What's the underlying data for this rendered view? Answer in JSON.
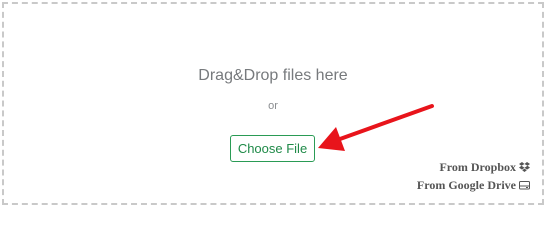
{
  "dropzone": {
    "title": "Drag&Drop files here",
    "or_text": "or",
    "choose_button": "Choose File"
  },
  "cloud_links": {
    "dropbox_label": "From Dropbox",
    "dropbox_icon": "dropbox-icon",
    "gdrive_label": "From Google Drive",
    "gdrive_icon": "google-drive-icon"
  },
  "colors": {
    "button_accent": "#2a9b55",
    "arrow": "#e8141b",
    "dashed_border": "#c9c9c9"
  }
}
